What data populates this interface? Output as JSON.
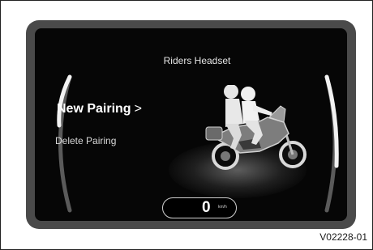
{
  "screen": {
    "title": "Riders Headset",
    "menu": {
      "items": [
        {
          "label": "New Pairing",
          "selected": true,
          "chevron": ">"
        },
        {
          "label": "Delete Pairing",
          "selected": false
        }
      ]
    },
    "speed": {
      "value": "0",
      "unit": "km/h"
    },
    "illustration_icon": "motorcycle-with-rider-and-passenger-icon"
  },
  "figure_reference": "V02228-01",
  "colors": {
    "screen_background": "#060606",
    "bezel": "#4a4a4a",
    "text_primary": "#ffffff",
    "text_secondary": "#d8d8d8"
  }
}
